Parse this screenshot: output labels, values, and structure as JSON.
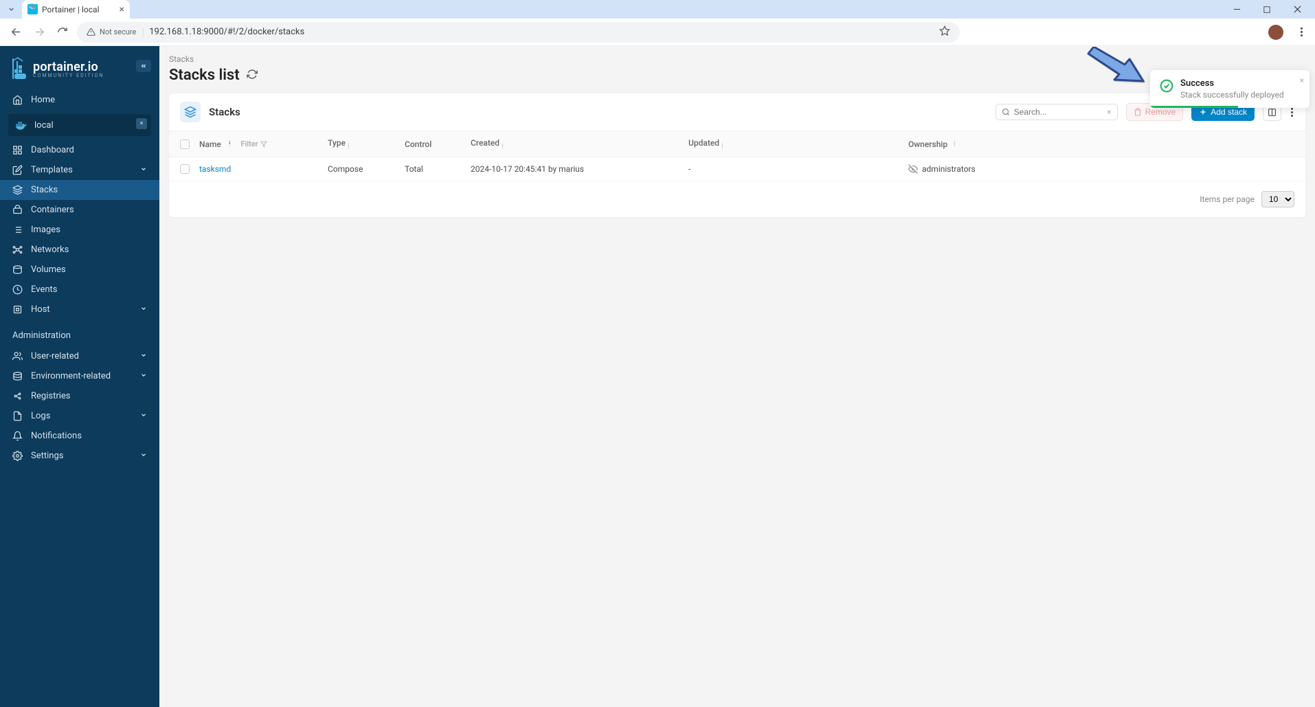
{
  "browser": {
    "tab_title": "Portainer | local",
    "security_label": "Not secure",
    "url": "192.168.1.18:9000/#!/2/docker/stacks"
  },
  "sidebar": {
    "logo_text": "portainer.io",
    "logo_edition": "COMMUNITY EDITION",
    "home": "Home",
    "env_name": "local",
    "items": [
      {
        "label": "Dashboard"
      },
      {
        "label": "Templates",
        "expandable": true
      },
      {
        "label": "Stacks",
        "active": true
      },
      {
        "label": "Containers"
      },
      {
        "label": "Images"
      },
      {
        "label": "Networks"
      },
      {
        "label": "Volumes"
      },
      {
        "label": "Events"
      },
      {
        "label": "Host",
        "expandable": true
      }
    ],
    "admin_label": "Administration",
    "admin_items": [
      {
        "label": "User-related",
        "expandable": true
      },
      {
        "label": "Environment-related",
        "expandable": true
      },
      {
        "label": "Registries"
      },
      {
        "label": "Logs",
        "expandable": true
      },
      {
        "label": "Notifications"
      },
      {
        "label": "Settings",
        "expandable": true
      }
    ]
  },
  "page": {
    "breadcrumb": "Stacks",
    "title": "Stacks list",
    "panel_title": "Stacks",
    "search_placeholder": "Search...",
    "remove_label": "Remove",
    "add_label": "Add stack",
    "columns": {
      "name": "Name",
      "filter": "Filter",
      "type": "Type",
      "control": "Control",
      "created": "Created",
      "updated": "Updated",
      "ownership": "Ownership"
    },
    "rows": [
      {
        "name": "tasksmd",
        "type": "Compose",
        "control": "Total",
        "created": "2024-10-17 20:45:41 by marius",
        "updated": "-",
        "ownership": "administrators"
      }
    ],
    "items_per_page_label": "Items per page",
    "items_per_page_value": "10"
  },
  "toast": {
    "title": "Success",
    "body": "Stack successfully deployed"
  }
}
